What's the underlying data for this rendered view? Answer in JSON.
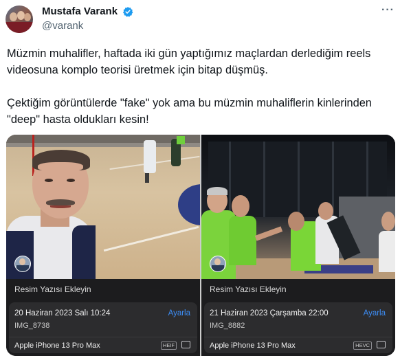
{
  "author": {
    "name": "Mustafa Varank",
    "handle": "@varank"
  },
  "icons": {
    "verified": "verified-badge-icon",
    "more": "more-options-icon"
  },
  "tweet": {
    "text": "Müzmin muhalifler, haftada iki gün yaptığımız maçlardan derlediğim reels videosuna komplo teorisi üretmek için bitap düşmüş.\n\nÇektiğim görüntülerde \"fake\" yok ama bu müzmin muhaliflerin kinlerinden \"deep\" hasta oldukları kesin!"
  },
  "photos": [
    {
      "caption": "Resim Yazısı Ekleyin",
      "date": "20 Haziran 2023 Salı 10:24",
      "adjust": "Ayarla",
      "file": "IMG_8738",
      "device": "Apple iPhone 13 Pro Max",
      "format": "HEIF"
    },
    {
      "caption": "Resim Yazısı Ekleyin",
      "date": "21 Haziran 2023 Çarşamba 22:00",
      "adjust": "Ayarla",
      "file": "IMG_8882",
      "device": "Apple iPhone 13 Pro Max",
      "format": "HEVC"
    }
  ],
  "colors": {
    "verified": "#1d9bf0",
    "link": "#3d8ef7",
    "photo_info_bg": "#1c1c1e"
  }
}
